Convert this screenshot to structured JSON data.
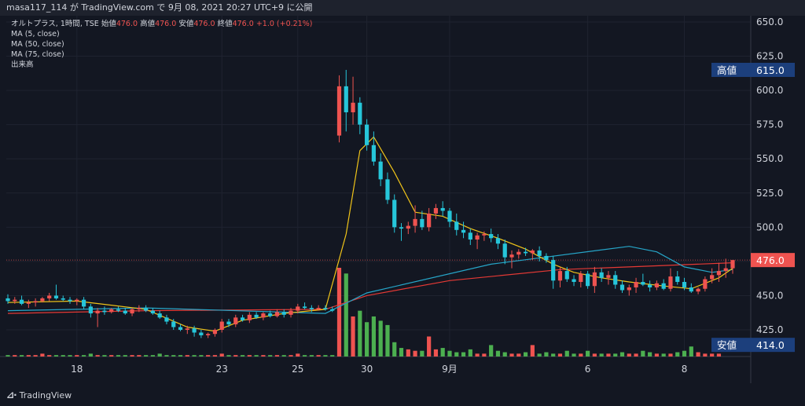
{
  "header": {
    "text": "masa117_114 が TradingView.com で 9月 08, 2021 20:27 UTC+9 に公開"
  },
  "legend": {
    "symbol": "オルトプラス, 1時間, TSE",
    "open_label": "始値",
    "open": "476.0",
    "high_label": "高値",
    "high": "476.0",
    "low_label": "安値",
    "low": "476.0",
    "close_label": "終値",
    "close": "476.0",
    "change": "+1.0 (+0.21%)",
    "ma5": "MA (5, close)",
    "ma50": "MA (50, close)",
    "ma75": "MA (75, close)",
    "volume": "出来高"
  },
  "tags": {
    "high_label": "高値",
    "high_value": "615.0",
    "low_label": "安値",
    "low_value": "414.0",
    "last_value": "476.0"
  },
  "footer": {
    "logo_text": "TradingView",
    "logo_icon": "tradingview-logo-icon"
  },
  "colors": {
    "up": "#ef5350",
    "down": "#26c6da",
    "vol_up": "#ef5350",
    "vol_down": "#4caf50",
    "ma5": "#f0c419",
    "ma50": "#e53935",
    "ma75": "#26a6c9",
    "tag_bg": "#1c3f7c"
  },
  "chart_data": {
    "type": "candlestick",
    "ylim": [
      410,
      650
    ],
    "y_ticks": [
      "650.0",
      "625.0",
      "600.0",
      "575.0",
      "550.0",
      "525.0",
      "500.0",
      "475.0",
      "450.0",
      "425.0"
    ],
    "x_ticks": [
      "18",
      "23",
      "25",
      "30",
      "9月",
      "6",
      "8"
    ],
    "ohlc": [
      [
        448,
        451,
        444,
        446
      ],
      [
        446,
        449,
        444,
        447
      ],
      [
        447,
        450,
        443,
        444
      ],
      [
        444,
        447,
        441,
        445
      ],
      [
        445,
        448,
        442,
        446
      ],
      [
        446,
        449,
        445,
        448
      ],
      [
        448,
        452,
        446,
        450
      ],
      [
        450,
        458,
        447,
        448
      ],
      [
        448,
        450,
        446,
        447
      ],
      [
        447,
        449,
        444,
        446
      ],
      [
        446,
        448,
        443,
        447
      ],
      [
        447,
        449,
        440,
        442
      ],
      [
        442,
        444,
        434,
        437
      ],
      [
        437,
        441,
        427,
        439
      ],
      [
        439,
        442,
        436,
        438
      ],
      [
        438,
        441,
        437,
        440
      ],
      [
        440,
        442,
        438,
        439
      ],
      [
        439,
        441,
        436,
        437
      ],
      [
        437,
        441,
        435,
        440
      ],
      [
        440,
        443,
        438,
        441
      ],
      [
        441,
        443,
        438,
        439
      ],
      [
        439,
        441,
        436,
        437
      ],
      [
        437,
        439,
        433,
        434
      ],
      [
        434,
        436,
        429,
        431
      ],
      [
        431,
        433,
        425,
        427
      ],
      [
        427,
        429,
        424,
        425
      ],
      [
        425,
        428,
        422,
        426
      ],
      [
        426,
        428,
        420,
        423
      ],
      [
        423,
        425,
        419,
        421
      ],
      [
        421,
        423,
        419,
        422
      ],
      [
        422,
        426,
        420,
        425
      ],
      [
        425,
        433,
        423,
        431
      ],
      [
        431,
        433,
        427,
        429
      ],
      [
        429,
        436,
        427,
        434
      ],
      [
        434,
        436,
        431,
        432
      ],
      [
        432,
        438,
        430,
        436
      ],
      [
        436,
        438,
        433,
        434
      ],
      [
        434,
        438,
        432,
        437
      ],
      [
        437,
        439,
        434,
        435
      ],
      [
        435,
        440,
        434,
        438
      ],
      [
        438,
        440,
        434,
        436
      ],
      [
        436,
        441,
        434,
        439
      ],
      [
        439,
        444,
        437,
        442
      ],
      [
        442,
        445,
        440,
        441
      ],
      [
        441,
        443,
        438,
        440
      ],
      [
        440,
        443,
        439,
        441
      ],
      [
        441,
        443,
        439,
        440
      ],
      [
        440,
        442,
        438,
        439
      ],
      [
        567,
        611,
        562,
        603
      ],
      [
        603,
        615,
        570,
        584
      ],
      [
        584,
        610,
        575,
        591
      ],
      [
        591,
        595,
        568,
        575
      ],
      [
        575,
        579,
        556,
        560
      ],
      [
        560,
        570,
        545,
        548
      ],
      [
        548,
        554,
        530,
        535
      ],
      [
        535,
        540,
        517,
        520
      ],
      [
        520,
        524,
        496,
        500
      ],
      [
        500,
        503,
        490,
        499
      ],
      [
        499,
        504,
        495,
        501
      ],
      [
        501,
        516,
        496,
        506
      ],
      [
        506,
        512,
        498,
        500
      ],
      [
        500,
        514,
        497,
        510
      ],
      [
        510,
        517,
        506,
        514
      ],
      [
        514,
        519,
        508,
        512
      ],
      [
        512,
        514,
        500,
        504
      ],
      [
        504,
        510,
        494,
        498
      ],
      [
        498,
        504,
        492,
        496
      ],
      [
        496,
        499,
        487,
        491
      ],
      [
        491,
        496,
        484,
        494
      ],
      [
        494,
        497,
        490,
        495
      ],
      [
        495,
        499,
        489,
        492
      ],
      [
        492,
        495,
        484,
        488
      ],
      [
        488,
        491,
        473,
        478
      ],
      [
        478,
        483,
        470,
        480
      ],
      [
        480,
        484,
        477,
        482
      ],
      [
        482,
        485,
        479,
        481
      ],
      [
        481,
        484,
        476,
        483
      ],
      [
        483,
        486,
        475,
        479
      ],
      [
        479,
        481,
        474,
        476
      ],
      [
        476,
        479,
        455,
        461
      ],
      [
        461,
        471,
        456,
        468
      ],
      [
        468,
        471,
        460,
        462
      ],
      [
        462,
        465,
        457,
        460
      ],
      [
        460,
        468,
        456,
        466
      ],
      [
        466,
        468,
        455,
        457
      ],
      [
        457,
        471,
        452,
        467
      ],
      [
        467,
        470,
        460,
        463
      ],
      [
        463,
        468,
        458,
        465
      ],
      [
        465,
        468,
        455,
        458
      ],
      [
        458,
        461,
        452,
        454
      ],
      [
        454,
        458,
        450,
        456
      ],
      [
        456,
        463,
        452,
        460
      ],
      [
        460,
        466,
        457,
        458
      ],
      [
        458,
        461,
        453,
        456
      ],
      [
        456,
        461,
        454,
        459
      ],
      [
        459,
        462,
        454,
        455
      ],
      [
        455,
        470,
        453,
        464
      ],
      [
        464,
        468,
        458,
        460
      ],
      [
        460,
        463,
        454,
        456
      ],
      [
        456,
        459,
        452,
        453
      ],
      [
        453,
        456,
        451,
        455
      ],
      [
        455,
        464,
        453,
        462
      ],
      [
        462,
        470,
        459,
        465
      ],
      [
        465,
        474,
        460,
        468
      ],
      [
        468,
        477,
        463,
        470
      ],
      [
        470,
        473,
        466,
        476
      ]
    ],
    "spike": [
      442,
      443,
      498
    ],
    "volume": [
      1,
      1,
      1,
      1,
      1,
      2,
      1,
      1,
      1,
      1,
      1,
      1,
      2,
      1,
      1,
      1,
      1,
      1,
      1,
      1,
      1,
      1,
      2,
      1,
      1,
      1,
      1,
      1,
      1,
      1,
      1,
      2,
      1,
      1,
      1,
      1,
      1,
      1,
      1,
      1,
      1,
      1,
      2,
      1,
      1,
      1,
      1,
      1,
      62,
      58,
      28,
      32,
      24,
      28,
      25,
      22,
      10,
      6,
      5,
      4,
      4,
      14,
      5,
      6,
      4,
      3,
      3,
      5,
      2,
      2,
      8,
      4,
      3,
      2,
      2,
      3,
      8,
      2,
      3,
      2,
      2,
      4,
      2,
      2,
      4,
      2,
      2,
      2,
      2,
      3,
      2,
      2,
      4,
      3,
      2,
      2,
      2,
      3,
      4,
      7,
      3,
      2,
      2,
      2
    ],
    "ma_points": {
      "ma5": [
        [
          0,
          445
        ],
        [
          10,
          446
        ],
        [
          20,
          440
        ],
        [
          26,
          427
        ],
        [
          30,
          424
        ],
        [
          34,
          432
        ],
        [
          40,
          437
        ],
        [
          46,
          440
        ],
        [
          49,
          495
        ],
        [
          51,
          556
        ],
        [
          53,
          566
        ],
        [
          56,
          540
        ],
        [
          59,
          511
        ],
        [
          63,
          508
        ],
        [
          67,
          499
        ],
        [
          71,
          492
        ],
        [
          75,
          484
        ],
        [
          79,
          473
        ],
        [
          82,
          467
        ],
        [
          86,
          463
        ],
        [
          90,
          460
        ],
        [
          95,
          457
        ],
        [
          99,
          455
        ],
        [
          103,
          463
        ],
        [
          105,
          470
        ]
      ],
      "ma50": [
        [
          0,
          437
        ],
        [
          20,
          439
        ],
        [
          46,
          440
        ],
        [
          52,
          450
        ],
        [
          64,
          461
        ],
        [
          80,
          469
        ],
        [
          95,
          472
        ],
        [
          105,
          474
        ]
      ],
      "ma75": [
        [
          0,
          439
        ],
        [
          20,
          441
        ],
        [
          46,
          437
        ],
        [
          52,
          452
        ],
        [
          70,
          473
        ],
        [
          90,
          486
        ],
        [
          94,
          482
        ],
        [
          98,
          471
        ],
        [
          102,
          467
        ],
        [
          105,
          469
        ]
      ]
    }
  }
}
